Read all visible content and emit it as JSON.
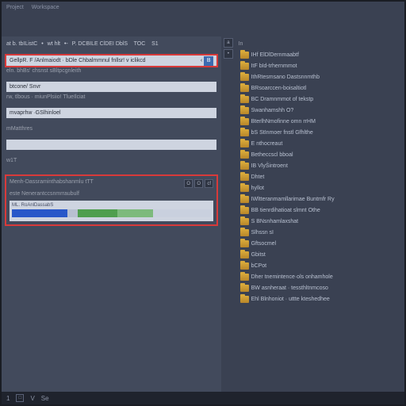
{
  "titlebar": {
    "item1": "Project",
    "item2": "Workspace"
  },
  "toolbar": {
    "segment1": "at b. tbIListC",
    "segment2": "wt hlt",
    "segment3": "P. DCBILE ClDEI  DblS",
    "segment4": "TOC",
    "segment5": "S1"
  },
  "inputs": {
    "row1": "GellpR. F /Anlmaiodt · bDle Chbalmmnul fnllsr! v iclikcd",
    "row2": "btcone/ Snvr",
    "row3": "mvaprhw ·GSlhinloel",
    "row4": ""
  },
  "icons": {
    "badge1": "B"
  },
  "labels": {
    "sub1": "eln. bhBs' chsnst sBltpcgnleith",
    "sub2": "rw,  tlbous · miunPlsiio! TlueIlciat",
    "sub3": "mMatthres",
    "sub4": "w1T",
    "panel1": "Menh-Dassraminthabshanmlu tTT",
    "panel2": "este Nenerantccsnmrraubulf",
    "right_top": "In"
  },
  "panel": {
    "btn1": "O",
    "btn2": "O",
    "btn3": "cf",
    "timeline_label": "ML. RoAnlDassabS"
  },
  "files": {
    "items": [
      "IHf ElDlDernmaabtf",
      "ItF bId-trhernmmot",
      "IthRtesmsano Dastsnnmthb",
      "BRsoarccen-boisaltiotl",
      "BC Dramnmmot of tekstp",
      "Swanhamshh  O?",
      "BterlhNmofinne omn  rrHM",
      "bS StInmoer fnstl Gfhlthe",
      "E nthocreaut",
      "Betheccscl bboal",
      "IB VlyŠintroent",
      "Dhtet",
      "hyllot",
      "IWltteranmamllarimae Buntmfr Ry",
      "BB tienrdihatioat slmnt Othe",
      "S BNsnhamlaxshat",
      "Slhssn sI",
      "Gftsocmel",
      "Gbitst",
      "bCPot",
      "Dher tnemintence·ols  onhamhole",
      "BW asnheraat · tessthltnmcoso",
      "Ehl Blnhoniot · uttte  kteshedhee"
    ]
  },
  "status": {
    "s1": "1",
    "s2": "□",
    "s3": "V",
    "s4": "Se"
  },
  "tools": {
    "t1": "a",
    "t2": "•"
  }
}
